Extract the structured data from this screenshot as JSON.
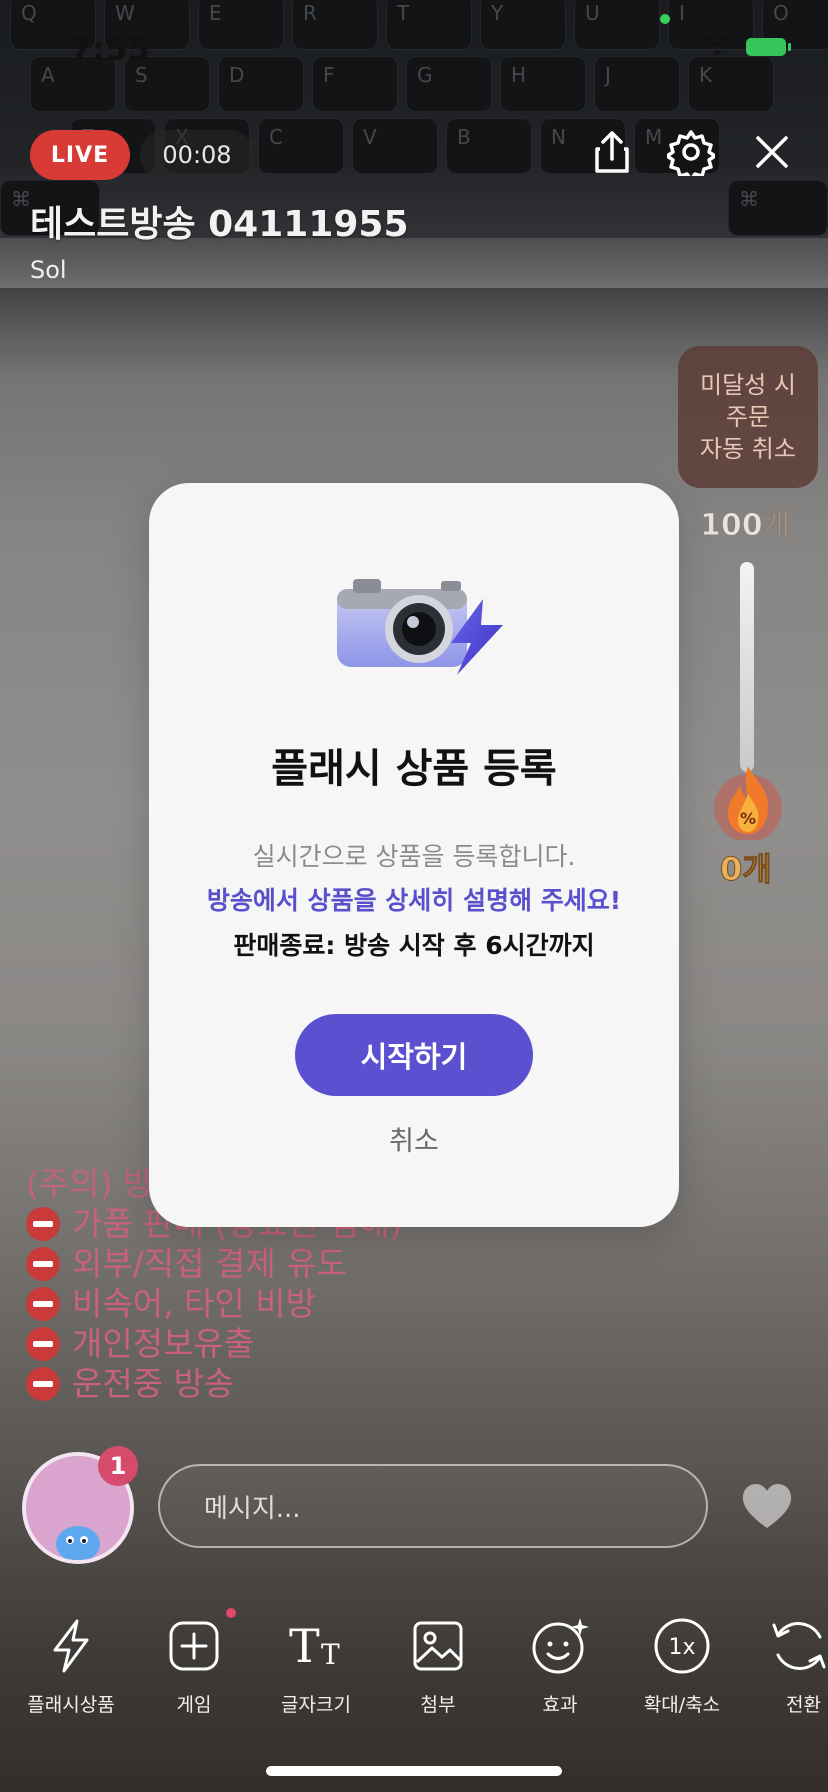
{
  "status_bar": {
    "time": "7:55"
  },
  "live": {
    "badge": "LIVE",
    "elapsed": "00:08"
  },
  "broadcast": {
    "title": "테스트방송 04111955",
    "host": "Sol"
  },
  "top_icons": [
    "share-icon",
    "gear-icon",
    "close-icon"
  ],
  "side_panel": {
    "auto_cancel_lines": [
      "미달성 시",
      "주문",
      "자동 취소"
    ],
    "gauge_max": "100개",
    "gauge_current": "0개",
    "flame_label": "%"
  },
  "notice": {
    "header": "(주의) 방송 운영정책 위반 시, 즉시 패널티",
    "items": [
      "가품 판매 (상표권 침해)",
      "외부/직접 결제 유도",
      "비속어, 타인 비방",
      "개인정보유출",
      "운전중 방송"
    ]
  },
  "chat": {
    "avatar_badge": "1",
    "input_placeholder": "메시지..."
  },
  "toolbar": {
    "items": [
      {
        "label": "플래시상품",
        "icon": "lightning-icon"
      },
      {
        "label": "게임",
        "icon": "plus-square-icon"
      },
      {
        "label": "글자크기",
        "icon": "text-size-icon"
      },
      {
        "label": "첨부",
        "icon": "image-icon"
      },
      {
        "label": "효과",
        "icon": "smile-sparkle-icon"
      },
      {
        "label": "확대/축소",
        "icon": "zoom-1x-icon"
      },
      {
        "label": "전환",
        "icon": "switch-camera-icon"
      }
    ],
    "zoom_text": "1x"
  },
  "modal": {
    "title": "플래시 상품 등록",
    "desc_line1": "실시간으로 상품을 등록합니다.",
    "desc_line2": "방송에서 상품을 상세히 설명해 주세요!",
    "desc_line3": "판매종료: 방송 시작 후 6시간까지",
    "start_label": "시작하기",
    "cancel_label": "취소",
    "accent_color": "#5b51d0"
  }
}
